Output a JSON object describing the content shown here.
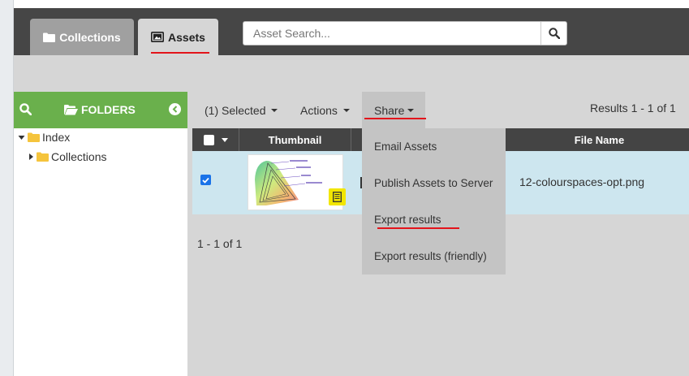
{
  "nav": {
    "tabs": [
      {
        "label": "Collections",
        "icon": "folder-icon"
      },
      {
        "label": "Assets",
        "icon": "images-icon"
      }
    ],
    "search": {
      "placeholder": "Asset Search...",
      "value": ""
    }
  },
  "sidebar": {
    "title": "FOLDERS",
    "tree": [
      {
        "label": "Index",
        "expanded": true
      },
      {
        "label": "Collections",
        "expanded": false
      }
    ]
  },
  "toolbar": {
    "selected_label": "(1) Selected",
    "actions_label": "Actions",
    "share_label": "Share",
    "results_text": "Results 1 - 1 of 1"
  },
  "share_menu": {
    "items": [
      "Email Assets",
      "Publish Assets to Server",
      "Export results",
      "Export results (friendly)"
    ]
  },
  "table": {
    "columns": [
      "Thumbnail",
      "File Name"
    ],
    "rows": [
      {
        "checked": true,
        "file_name": "12-colourspaces-opt.png"
      }
    ]
  },
  "pager": {
    "text": "1 - 1 of 1"
  },
  "colors": {
    "navbar": "#464646",
    "sidebar_header": "#6ab04c",
    "accent_underline": "#e3141b",
    "selected_row": "#cde6ef",
    "menu_bg": "#c4c4c4"
  }
}
